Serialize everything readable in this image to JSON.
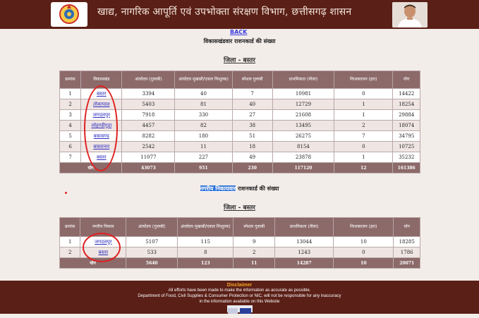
{
  "header": {
    "title": "खाद्य, नागरिक आपूर्ति एवं उपभोक्ता संरक्षण विभाग, छत्तीसगढ़ शासन",
    "emblem_icon": "state-emblem-icon",
    "portrait_icon": "minister-portrait",
    "bg_color": "#5a1f16"
  },
  "nav": {
    "back_label": "BACK"
  },
  "page_heading": "विकासखंडवार राशनकार्ड की संख्या",
  "section1": {
    "district_label": "जिला - बस्तर",
    "columns": [
      "क्रमांक",
      "विकासखंड",
      "अंत्योदय (गुलाबी)",
      "अंत्योदय मुखाबी/एकल निःशुल्क)",
      "स्पेशल गुलाबी",
      "प्राथमिकता (नीला)",
      "निःशक्तजन (हरा)",
      "योग"
    ],
    "rows": [
      [
        "1",
        "बस्तर",
        "3394",
        "40",
        "7",
        "10981",
        "0",
        "14422"
      ],
      [
        "2",
        "तोकापाल",
        "5403",
        "81",
        "40",
        "12729",
        "1",
        "18254"
      ],
      [
        "3",
        "जगदलपुर",
        "7918",
        "330",
        "27",
        "21608",
        "1",
        "29884"
      ],
      [
        "4",
        "लोहण्डीगुडा",
        "4457",
        "82",
        "38",
        "13495",
        "2",
        "18074"
      ],
      [
        "5",
        "बकावण्ड",
        "8282",
        "180",
        "51",
        "26275",
        "7",
        "34795"
      ],
      [
        "6",
        "बास्तानार",
        "2542",
        "11",
        "18",
        "8154",
        "0",
        "10725"
      ],
      [
        "7",
        "बस्तर",
        "11077",
        "227",
        "49",
        "23878",
        "1",
        "35232"
      ]
    ],
    "total": [
      "योग",
      "43073",
      "951",
      "230",
      "117120",
      "12",
      "161386"
    ]
  },
  "section2": {
    "heading_link": "नगरीय निकायवार",
    "heading_rest": " राशनकार्ड की संख्या",
    "district_label": "जिला - बस्तर",
    "columns": [
      "क्रमांक",
      "नगरीय निकाय",
      "अंत्योदय (गुलाबी)",
      "अंत्योदय मुखाबी/एकल निःशुल्क)",
      "स्पेशल गुलाबी",
      "प्राथमिकता (नीला)",
      "निःशक्तजन (हरा)",
      "योग"
    ],
    "rows": [
      [
        "1",
        "जगदलपुर",
        "5107",
        "115",
        "9",
        "13044",
        "10",
        "18285"
      ],
      [
        "2",
        "बस्तर",
        "533",
        "8",
        "2",
        "1243",
        "0",
        "1786"
      ]
    ],
    "total": [
      "योग",
      "5640",
      "123",
      "11",
      "14287",
      "10",
      "20071"
    ]
  },
  "footer": {
    "disclaimer_title": "Disclaimer",
    "line1": "All efforts have been made to make the information as accurate as possible.",
    "line2": "Department of Food, Civil Supplies & Consumer Protection or NIC, will not be responsible for any inaccuracy",
    "line3": "in the information available on this Website",
    "logo_icon": "nic-logo"
  },
  "colors": {
    "table_header": "#8c6a6a",
    "annotation_red": "#e02020",
    "link_blue": "#2d2dbf"
  }
}
